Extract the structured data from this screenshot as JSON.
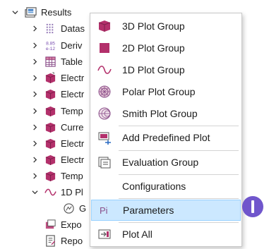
{
  "tree": {
    "root": {
      "label": "Results",
      "icon": "results-folder-icon"
    },
    "items": [
      {
        "label": "Datas",
        "icon": "datasets-grid-icon"
      },
      {
        "label": "Deriv",
        "icon": "derived-values-icon",
        "badge_top": "8.85",
        "badge_bottom": "e-12"
      },
      {
        "label": "Table",
        "icon": "table-icon"
      },
      {
        "label": "Electr",
        "icon": "plot-group-3d-icon"
      },
      {
        "label": "Electr",
        "icon": "plot-group-3d-icon"
      },
      {
        "label": "Temp",
        "icon": "plot-group-3d-icon"
      },
      {
        "label": "Curre",
        "icon": "plot-group-3d-icon"
      },
      {
        "label": "Electr",
        "icon": "plot-group-3d-icon"
      },
      {
        "label": "Electr",
        "icon": "plot-group-3d-icon"
      },
      {
        "label": "Temp",
        "icon": "plot-group-3d-icon"
      },
      {
        "label": "1D Pl",
        "icon": "plot-group-1d-icon"
      },
      {
        "label": "G",
        "icon": "global-plot-icon"
      },
      {
        "label": "Expo",
        "icon": "export-icon"
      },
      {
        "label": "Repo",
        "icon": "report-icon"
      }
    ]
  },
  "context_menu": {
    "items": [
      {
        "label": "3D Plot Group",
        "icon": "plot-group-3d-icon"
      },
      {
        "label": "2D Plot Group",
        "icon": "plot-group-2d-icon"
      },
      {
        "label": "1D Plot Group",
        "icon": "plot-group-1d-icon"
      },
      {
        "label": "Polar Plot Group",
        "icon": "polar-plot-group-icon"
      },
      {
        "label": "Smith Plot Group",
        "icon": "smith-plot-group-icon"
      },
      {
        "label": "Add Predefined Plot",
        "icon": "add-predefined-plot-icon"
      },
      {
        "label": "Evaluation Group",
        "icon": "evaluation-group-icon"
      },
      {
        "label": "Configurations",
        "icon": ""
      },
      {
        "label": "Parameters",
        "icon": "parameters-icon",
        "icon_text": "Pi"
      },
      {
        "label": "Plot All",
        "icon": "plot-all-icon"
      }
    ],
    "hover_index": 8
  },
  "colors": {
    "accent_purple": "#b3306b",
    "hover_bg": "#cce8ff",
    "marker": "#7056cc"
  }
}
